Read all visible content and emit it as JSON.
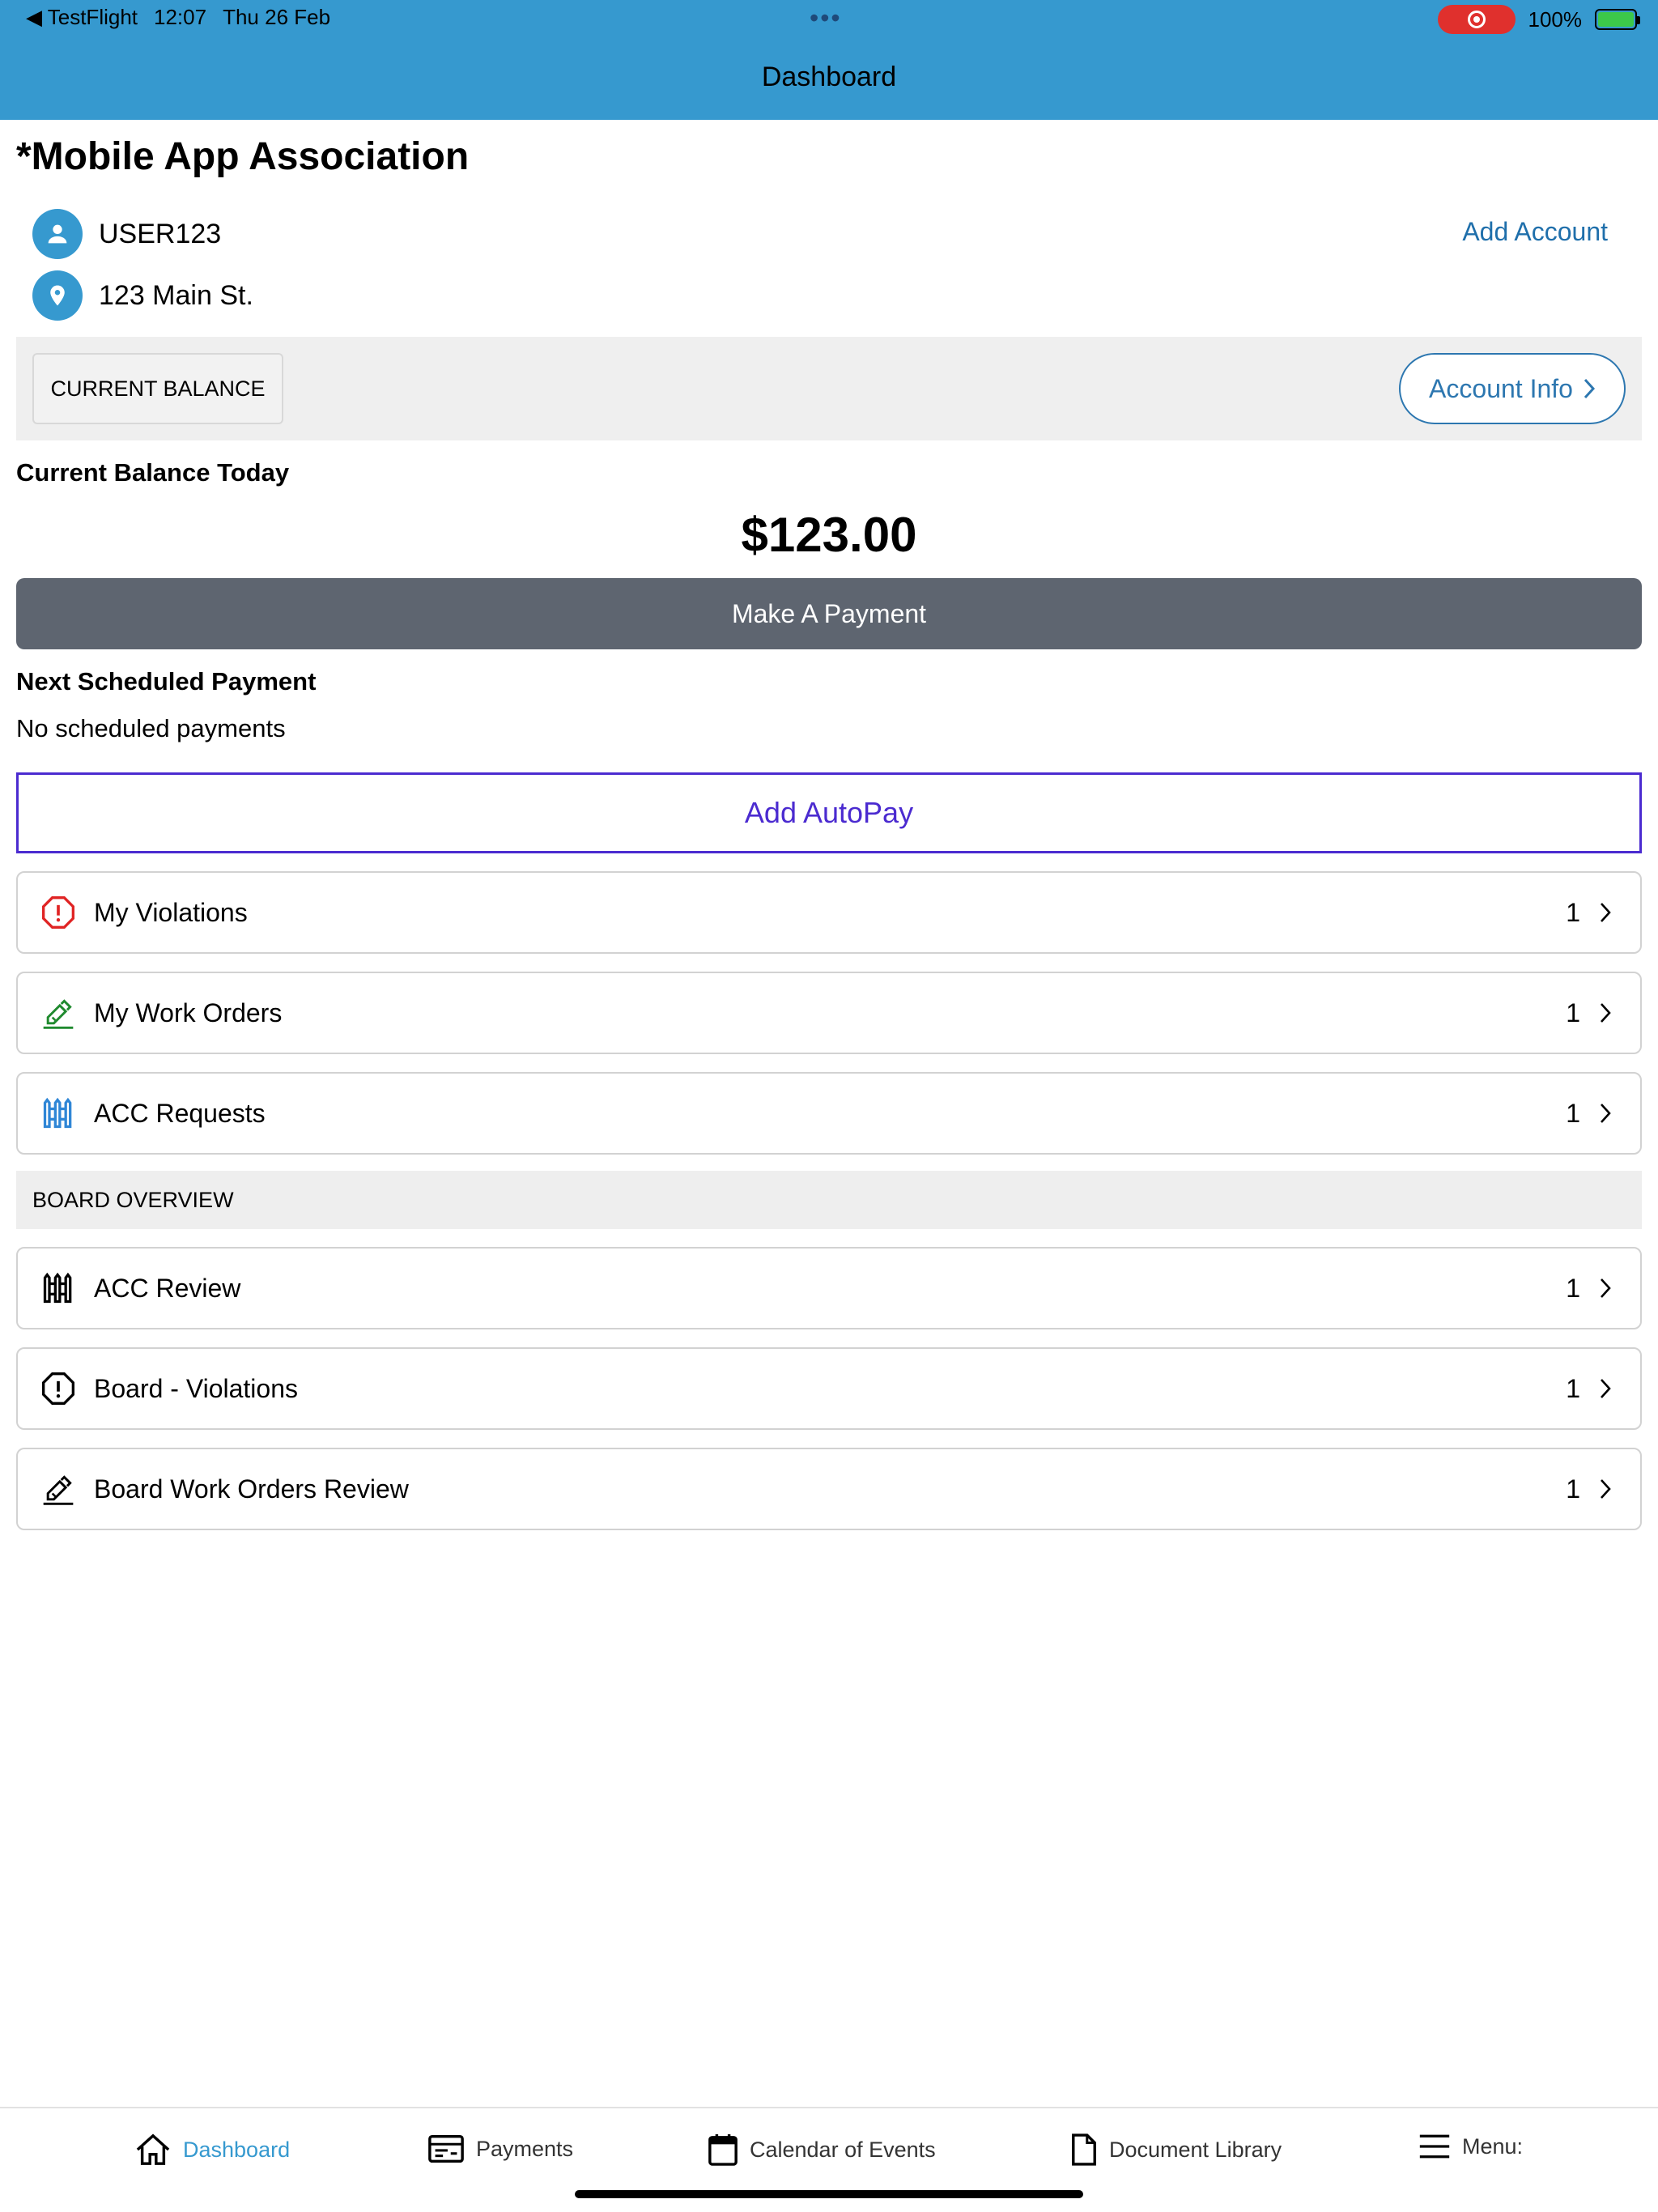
{
  "status_bar": {
    "back_app": "◀ TestFlight",
    "time": "12:07",
    "date": "Thu 26 Feb",
    "dots": "•••",
    "battery": "100%"
  },
  "header": {
    "title": "Dashboard"
  },
  "association": {
    "name": "*Mobile App Association",
    "user": "USER123",
    "address": "123 Main St.",
    "add_account_label": "Add Account"
  },
  "balance": {
    "tab_label": "CURRENT BALANCE",
    "account_info_label": "Account Info",
    "today_label": "Current Balance Today",
    "amount": "$123.00",
    "make_payment_label": "Make A Payment"
  },
  "scheduled": {
    "heading": "Next Scheduled Payment",
    "text": "No scheduled payments",
    "autopay_label": "Add AutoPay"
  },
  "my_items": [
    {
      "label": "My Violations",
      "count": "1",
      "icon": "violation-icon",
      "color": "#e02424"
    },
    {
      "label": "My Work Orders",
      "count": "1",
      "icon": "work-order-icon",
      "color": "#1f8a2e"
    },
    {
      "label": "ACC Requests",
      "count": "1",
      "icon": "fence-icon",
      "color": "#2f86d6"
    }
  ],
  "board": {
    "section_label": "BOARD OVERVIEW",
    "items": [
      {
        "label": "ACC Review",
        "count": "1",
        "icon": "fence-icon",
        "color": "#000000"
      },
      {
        "label": "Board - Violations",
        "count": "1",
        "icon": "violation-icon",
        "color": "#000000"
      },
      {
        "label": "Board Work Orders Review",
        "count": "1",
        "icon": "work-order-icon",
        "color": "#000000"
      }
    ]
  },
  "tabbar": {
    "tabs": [
      {
        "label": "Dashboard",
        "icon": "home-icon",
        "active": true
      },
      {
        "label": "Payments",
        "icon": "payments-icon",
        "active": false
      },
      {
        "label": "Calendar of Events",
        "icon": "calendar-icon",
        "active": false
      },
      {
        "label": "Document Library",
        "icon": "document-icon",
        "active": false
      },
      {
        "label": "Menu:",
        "icon": "menu-icon",
        "active": false
      }
    ]
  },
  "colors": {
    "brand_blue": "#3699cf",
    "autopay_purple": "#4b2bd0",
    "payment_button": "#5e6570"
  }
}
